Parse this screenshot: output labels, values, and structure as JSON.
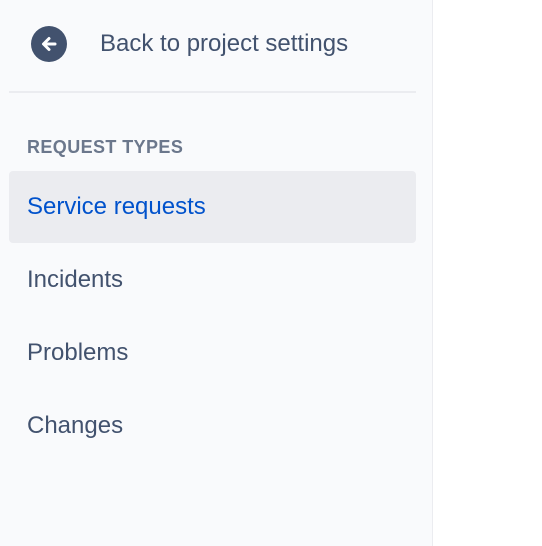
{
  "sidebar": {
    "back": {
      "icon": "arrow-left-circle-icon",
      "label": "Back to project settings"
    },
    "section_heading": "REQUEST TYPES",
    "items": [
      {
        "label": "Service requests",
        "selected": true
      },
      {
        "label": "Incidents",
        "selected": false
      },
      {
        "label": "Problems",
        "selected": false
      },
      {
        "label": "Changes",
        "selected": false
      }
    ]
  },
  "colors": {
    "sidebar_bg": "#f9fafc",
    "selected_bg": "#ebecf0",
    "selected_text": "#0052cc",
    "text": "#42526e",
    "heading_text": "#6b778c",
    "icon_bg": "#42526e"
  }
}
